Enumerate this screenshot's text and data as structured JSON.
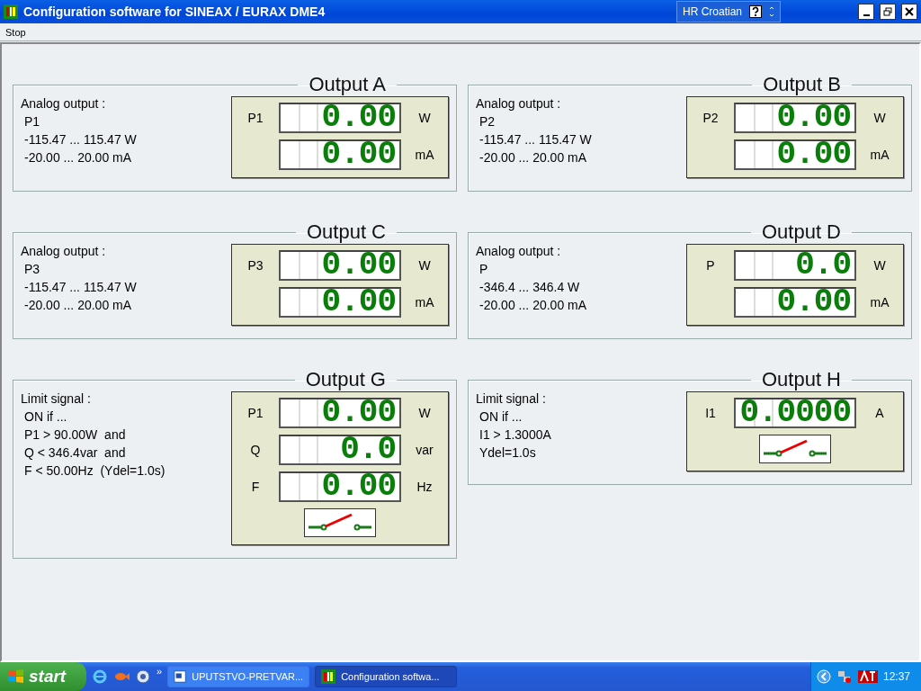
{
  "window": {
    "title": "Configuration software for SINEAX / EURAX DME4",
    "language": "HR Croatian"
  },
  "menu": [
    "Stop"
  ],
  "panels": [
    {
      "title": "Output A",
      "info": [
        "Analog output :",
        "P1",
        "-115.47 ... 115.47 W",
        "-20.00 ... 20.00 mA"
      ],
      "rows": [
        {
          "label": "P1",
          "value": "0.00",
          "unit": "W"
        },
        {
          "label": "",
          "value": "0.00",
          "unit": "mA"
        }
      ]
    },
    {
      "title": "Output B",
      "info": [
        "Analog output :",
        "P2",
        "-115.47 ... 115.47 W",
        "-20.00 ... 20.00 mA"
      ],
      "rows": [
        {
          "label": "P2",
          "value": "0.00",
          "unit": "W"
        },
        {
          "label": "",
          "value": "0.00",
          "unit": "mA"
        }
      ]
    },
    {
      "title": "Output C",
      "info": [
        "Analog output :",
        "P3",
        "-115.47 ... 115.47 W",
        "-20.00 ... 20.00 mA"
      ],
      "rows": [
        {
          "label": "P3",
          "value": "0.00",
          "unit": "W"
        },
        {
          "label": "",
          "value": "0.00",
          "unit": "mA"
        }
      ]
    },
    {
      "title": "Output D",
      "info": [
        "Analog output :",
        "P",
        "-346.4 ... 346.4 W",
        "-20.00 ... 20.00 mA"
      ],
      "rows": [
        {
          "label": "P",
          "value": "0.0",
          "unit": "W"
        },
        {
          "label": "",
          "value": "0.00",
          "unit": "mA"
        }
      ]
    },
    {
      "title": "Output G",
      "info": [
        "Limit signal :",
        "ON if ...",
        "P1 > 90.00W  and",
        "Q < 346.4var  and",
        "F < 50.00Hz  (Ydel=1.0s)"
      ],
      "rows": [
        {
          "label": "P1",
          "value": "0.00",
          "unit": "W"
        },
        {
          "label": "Q",
          "value": "0.0",
          "unit": "var"
        },
        {
          "label": "F",
          "value": "0.00",
          "unit": "Hz"
        }
      ],
      "switch": {
        "closed": false
      }
    },
    {
      "title": "Output H",
      "info": [
        "Limit signal :",
        "ON if ...",
        "I1 > 1.3000A",
        "Ydel=1.0s"
      ],
      "rows": [
        {
          "label": "I1",
          "value": "0.0000",
          "unit": "A"
        }
      ],
      "switch": {
        "closed": false
      }
    }
  ],
  "taskbar": {
    "start": "start",
    "quick_launch_more": "»",
    "tasks": [
      {
        "label": "UPUTSTVO-PRETVAR...",
        "kind": "document",
        "selected": false
      },
      {
        "label": "Configuration softwa...",
        "kind": "app",
        "selected": true
      }
    ],
    "clock": "12:37"
  }
}
